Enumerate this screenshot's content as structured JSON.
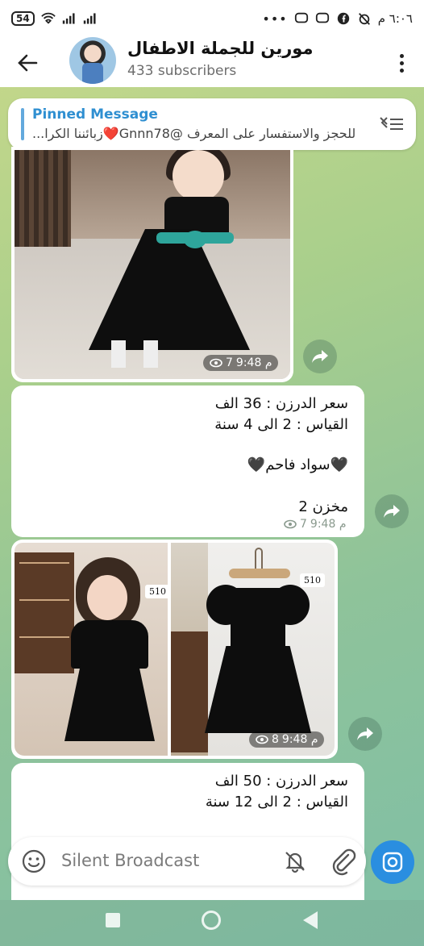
{
  "status_bar": {
    "battery": "54",
    "time": "٦:٠٦ م"
  },
  "header": {
    "title": "مورين للجملة الاطفال",
    "subscribers": "433 subscribers"
  },
  "pinned": {
    "label": "Pinned Message",
    "text": "للحجز والاستفسار على المعرف  @Gnnn78❤️زبائننا الكرا..."
  },
  "messages": [
    {
      "type": "photo",
      "views": "7",
      "time": "9:48 م"
    },
    {
      "type": "text",
      "lines": [
        "سعر الدرزن : 36 الف",
        "القياس   :  2 الى 4 سنة",
        "",
        "🖤سواد فاحم🖤",
        "",
        "مخزن 2"
      ],
      "views": "7",
      "time": "9:48 م"
    },
    {
      "type": "album",
      "tag_left": "510",
      "tag_right": "510",
      "views": "8",
      "time": "9:48 م"
    },
    {
      "type": "text",
      "lines": [
        "سعر الدرزن : 50 الف",
        "القياس   :  2 الى 12 سنة"
      ]
    }
  ],
  "input": {
    "placeholder": "Silent Broadcast"
  },
  "colors": {
    "accent": "#2a8ee0",
    "pinned_label": "#2f8fd1"
  }
}
